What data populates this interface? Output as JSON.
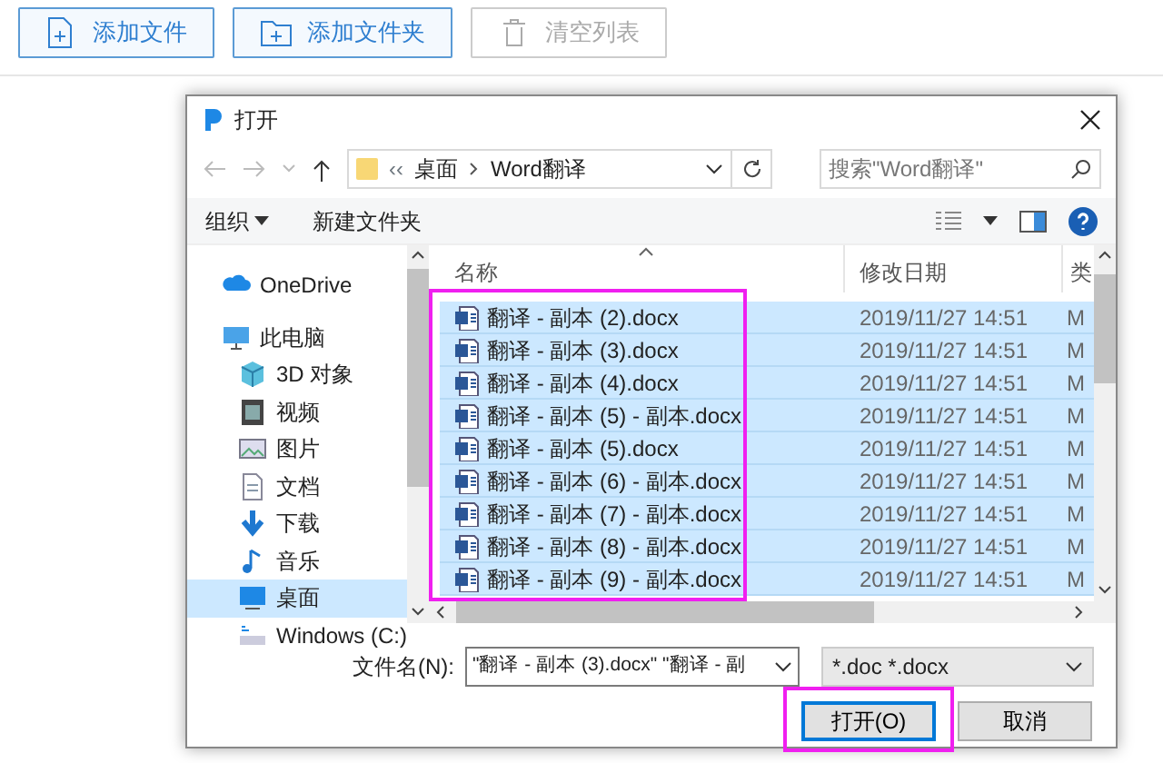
{
  "top_buttons": [
    {
      "label": "添加文件",
      "kind": "file",
      "disabled": false
    },
    {
      "label": "添加文件夹",
      "kind": "folder",
      "disabled": false
    },
    {
      "label": "清空列表",
      "kind": "trash",
      "disabled": true
    }
  ],
  "dialog": {
    "title": "打开",
    "address": {
      "overflow": "‹‹",
      "path": [
        "桌面",
        "Word翻译"
      ]
    },
    "search": {
      "placeholder": "搜索\"Word翻译\""
    },
    "toolbar": {
      "organize": "组织",
      "new_folder": "新建文件夹"
    },
    "sidebar": {
      "items": [
        {
          "label": "OneDrive",
          "kind": "cloud",
          "selected": false
        },
        {
          "label": "此电脑",
          "kind": "pc",
          "selected": false,
          "children": [
            {
              "label": "3D 对象",
              "kind": "cube",
              "selected": false
            },
            {
              "label": "视频",
              "kind": "video",
              "selected": false
            },
            {
              "label": "图片",
              "kind": "picture",
              "selected": false
            },
            {
              "label": "文档",
              "kind": "doc",
              "selected": false
            },
            {
              "label": "下载",
              "kind": "download",
              "selected": false
            },
            {
              "label": "音乐",
              "kind": "music",
              "selected": false
            },
            {
              "label": "桌面",
              "kind": "desktop",
              "selected": true
            },
            {
              "label": "Windows (C:)",
              "kind": "drive",
              "selected": false
            }
          ]
        }
      ]
    },
    "columns": [
      "名称",
      "修改日期",
      "类"
    ],
    "rows": [
      {
        "name": "翻译 - 副本 (2).docx",
        "date": "2019/11/27 14:51",
        "type": "M",
        "selected": true
      },
      {
        "name": "翻译 - 副本 (3).docx",
        "date": "2019/11/27 14:51",
        "type": "M",
        "selected": true
      },
      {
        "name": "翻译 - 副本 (4).docx",
        "date": "2019/11/27 14:51",
        "type": "M",
        "selected": true
      },
      {
        "name": "翻译 - 副本 (5) - 副本.docx",
        "date": "2019/11/27 14:51",
        "type": "M",
        "selected": true
      },
      {
        "name": "翻译 - 副本 (5).docx",
        "date": "2019/11/27 14:51",
        "type": "M",
        "selected": true
      },
      {
        "name": "翻译 - 副本 (6) - 副本.docx",
        "date": "2019/11/27 14:51",
        "type": "M",
        "selected": true
      },
      {
        "name": "翻译 - 副本 (7) - 副本.docx",
        "date": "2019/11/27 14:51",
        "type": "M",
        "selected": true
      },
      {
        "name": "翻译 - 副本 (8) - 副本.docx",
        "date": "2019/11/27 14:51",
        "type": "M",
        "selected": true
      },
      {
        "name": "翻译 - 副本 (9) - 副本.docx",
        "date": "2019/11/27 14:51",
        "type": "M",
        "selected": true
      }
    ],
    "filename": {
      "label": "文件名(N):",
      "value": "\"翻译 - 副本 (3).docx\" \"翻译 - 副"
    },
    "filter": {
      "value": "*.doc *.docx"
    },
    "buttons": [
      {
        "label": "打开(O)",
        "kind": "primary",
        "highlighted": true
      },
      {
        "label": "取消",
        "kind": "secondary",
        "highlighted": false
      }
    ],
    "file_list_highlighted": true
  }
}
